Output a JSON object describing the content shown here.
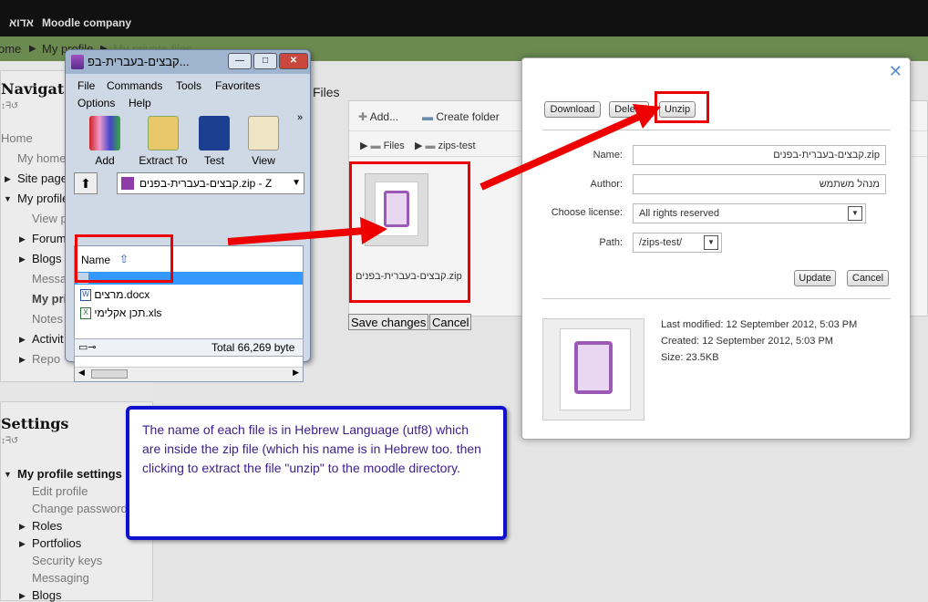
{
  "topbar": {
    "hebrew_link": "אדוא",
    "company": "Moodle company"
  },
  "breadcrumb": {
    "home": "ome",
    "sep": "▶",
    "profile": "My profile",
    "files": "My private files"
  },
  "navigation": {
    "title": "Navigati",
    "home": "Home",
    "my_home": "My home",
    "site_pages": "Site page",
    "my_profile": "My profile",
    "view_profile": "View p",
    "forums": "Forum",
    "blogs": "Blogs",
    "messages": "Messa",
    "my_private": "My pri",
    "notes": "Notes",
    "activity": "Activit",
    "reports": "Repo"
  },
  "settings": {
    "title": "Settings",
    "profile_settings": "My profile settings",
    "edit_profile": "Edit profile",
    "change_password": "Change password",
    "roles": "Roles",
    "portfolios": "Portfolios",
    "security_keys": "Security keys",
    "messaging": "Messaging",
    "blogs": "Blogs"
  },
  "files_page": {
    "heading": "Files",
    "add": "Add...",
    "create_folder": "Create folder",
    "path_files": "Files",
    "path_zips": "zips-test",
    "zip_name": "קבצים-בעברית-בפנים.zip",
    "save": "Save changes",
    "cancel": "Cancel"
  },
  "winrar": {
    "title": "קבצים-בעברית-בפ...",
    "menu": [
      "File",
      "Commands",
      "Tools",
      "Favorites",
      "Options",
      "Help"
    ],
    "toolbar": [
      "Add",
      "Extract To",
      "Test",
      "View"
    ],
    "path": "קבצים-בעברית-בפנים.zip - Z",
    "col_name": "Name",
    "files": [
      "מרצים.docx",
      "תכן אקלימי.xls"
    ],
    "status": "Total 66,269 byte"
  },
  "dialog": {
    "download": "Download",
    "delete": "Delete",
    "unzip": "Unzip",
    "name_label": "Name:",
    "name_value": "קבצים-בעברית-בפנים.zip",
    "author_label": "Author:",
    "author_value": "מנהל משתמש",
    "license_label": "Choose license:",
    "license_value": "All rights reserved",
    "path_label": "Path:",
    "path_value": "/zips-test/",
    "update": "Update",
    "cancel": "Cancel",
    "last_modified": "Last modified: 12 September 2012, 5:03 PM",
    "created": "Created: 12 September 2012, 5:03 PM",
    "size": "Size: 23.5KB"
  },
  "note": "The name of each file is in Hebrew Language (utf8) which are inside the zip file (which his name is in Hebrew too. then clicking to extract the file \"unzip\" to the moodle directory.",
  "colors": {
    "annotation_red": "#e00000",
    "note_border": "#1010d0",
    "note_text": "#3a1e8c"
  }
}
